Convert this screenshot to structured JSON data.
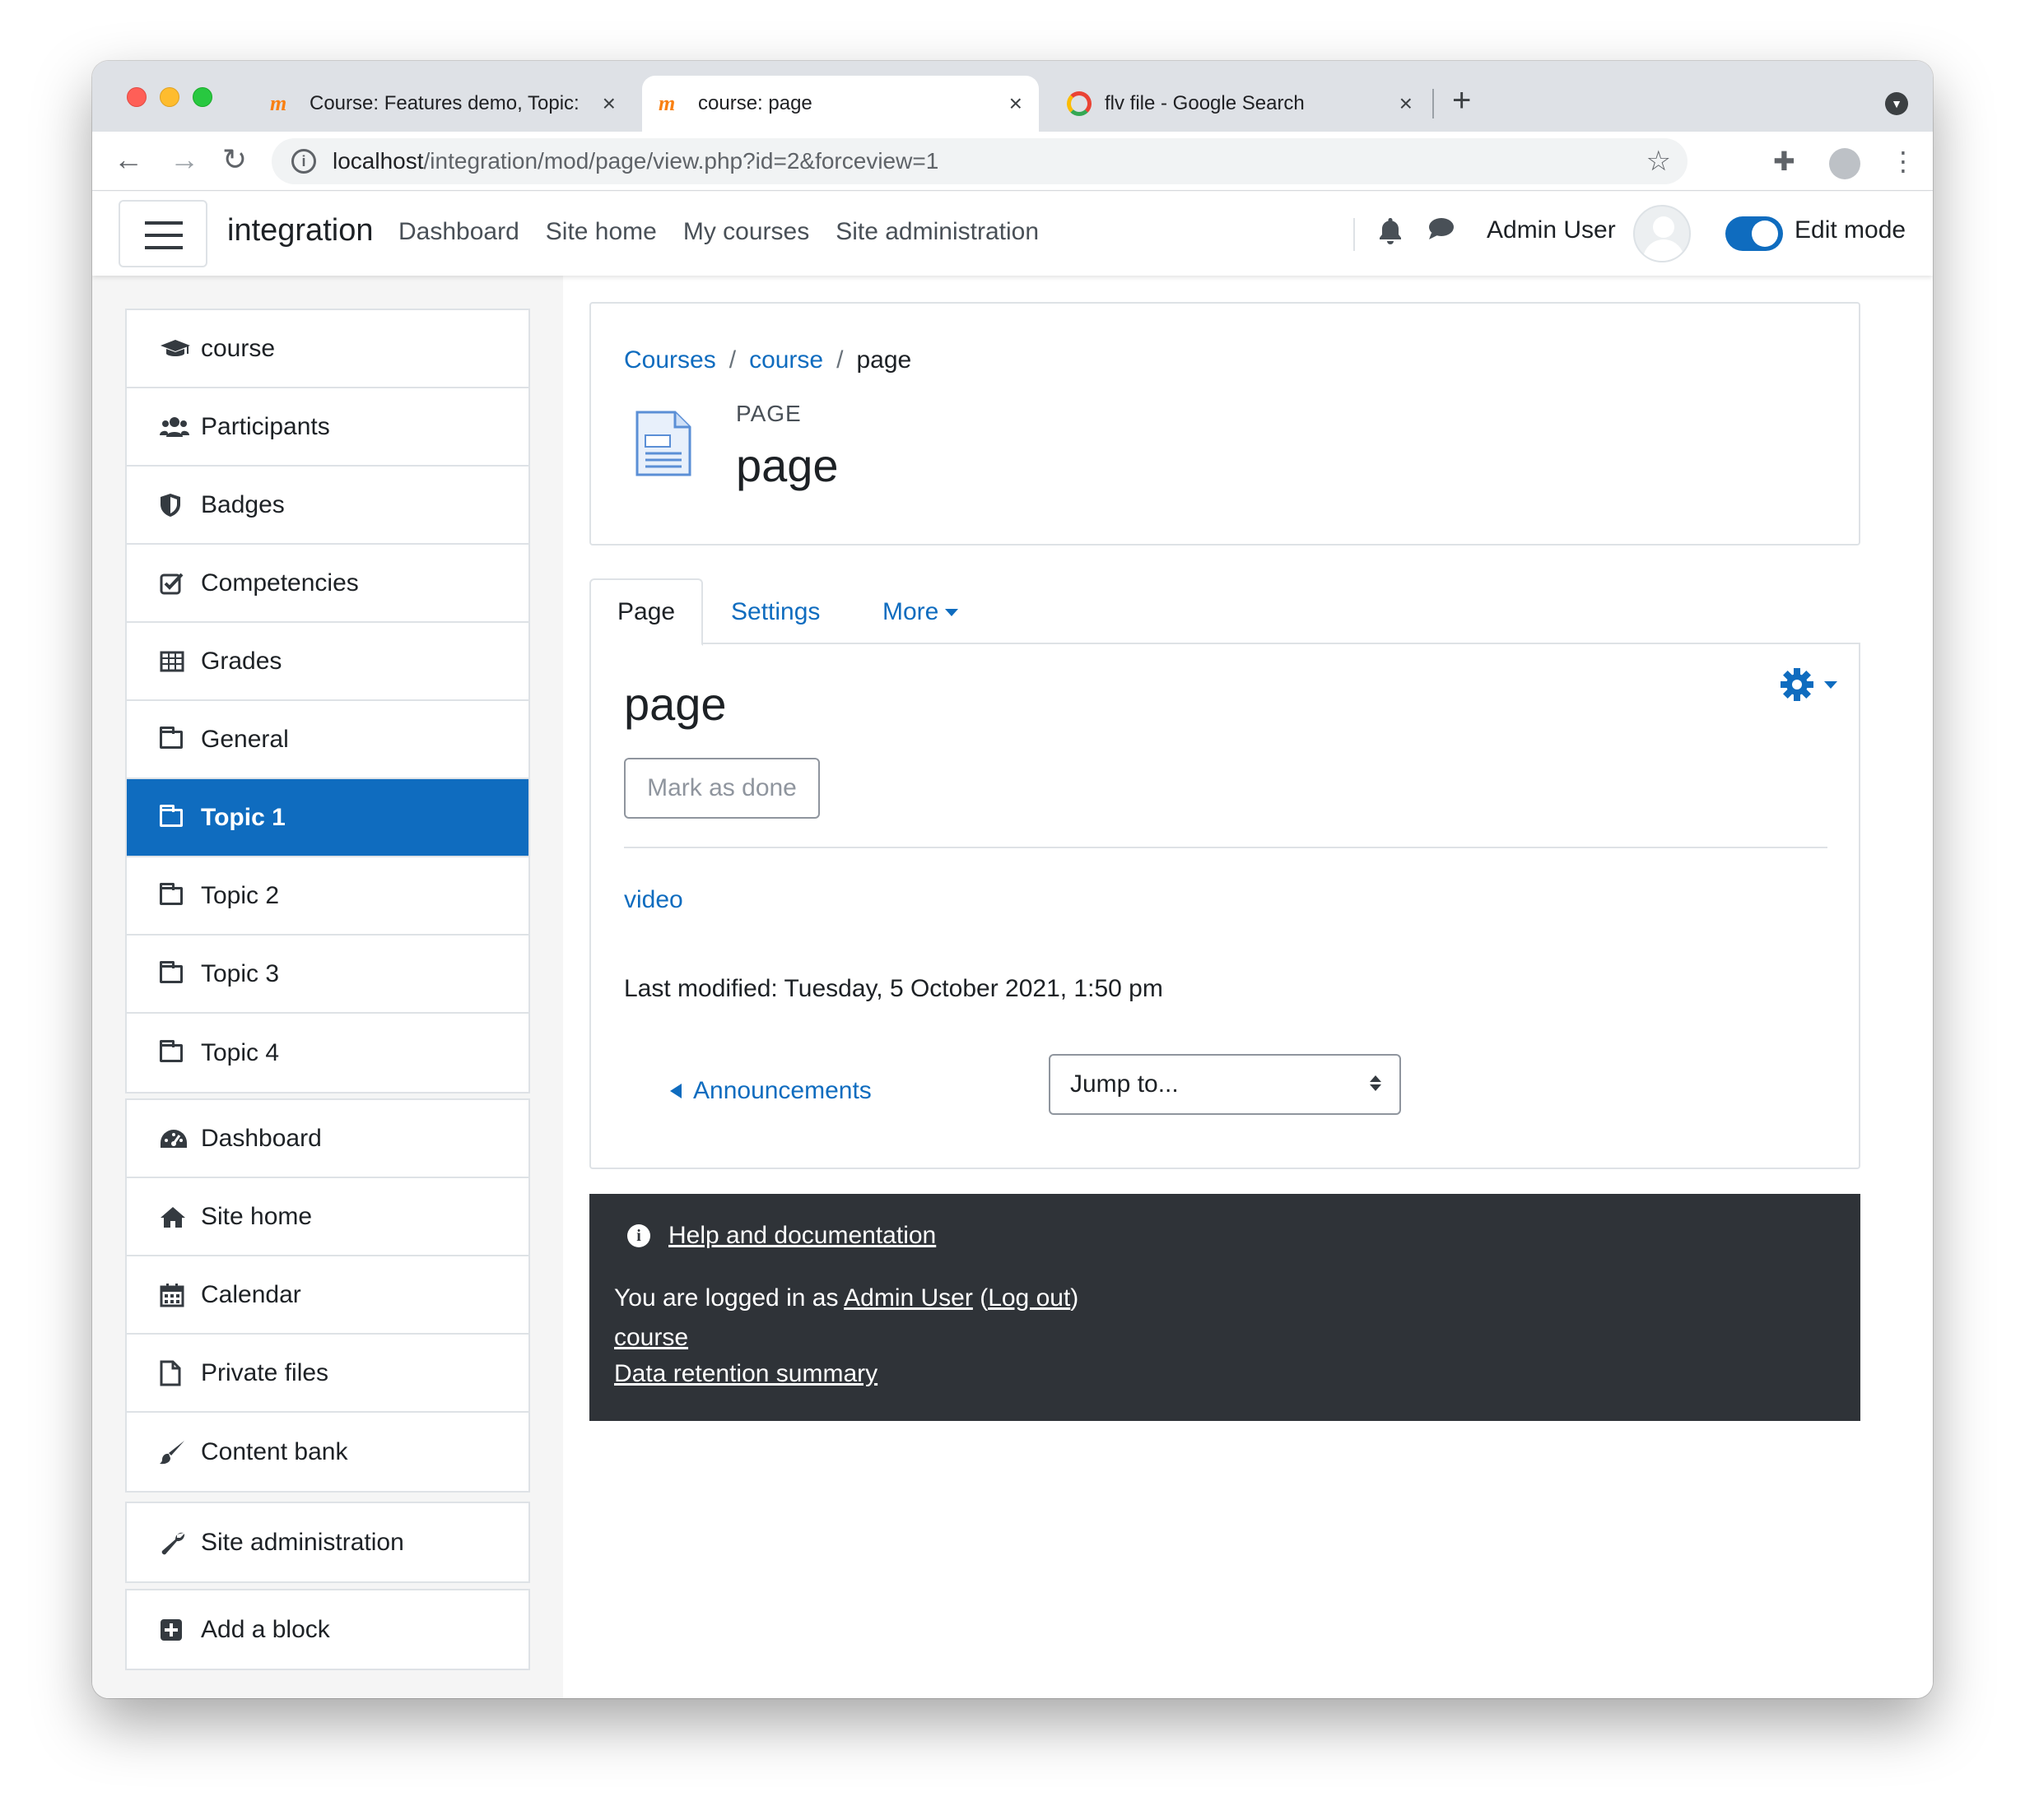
{
  "browser": {
    "tabs": [
      {
        "label": "Course: Features demo, Topic:",
        "active": false
      },
      {
        "label": "course: page",
        "active": true
      },
      {
        "label": "flv file - Google Search",
        "active": false
      }
    ],
    "url_host": "localhost",
    "url_path": "/integration/mod/page/view.php?id=2&forceview=1"
  },
  "navbar": {
    "brand": "integration",
    "links": [
      "Dashboard",
      "Site home",
      "My courses",
      "Site administration"
    ],
    "user": "Admin User",
    "edit_mode_label": "Edit mode",
    "edit_mode_on": true
  },
  "drawer": {
    "course_items": [
      {
        "label": "course",
        "icon": "graduation-cap-icon"
      },
      {
        "label": "Participants",
        "icon": "users-icon"
      },
      {
        "label": "Badges",
        "icon": "shield-icon"
      },
      {
        "label": "Competencies",
        "icon": "checkbox-icon"
      },
      {
        "label": "Grades",
        "icon": "table-icon"
      },
      {
        "label": "General",
        "icon": "folder-icon"
      },
      {
        "label": "Topic 1",
        "icon": "folder-icon",
        "active": true
      },
      {
        "label": "Topic 2",
        "icon": "folder-icon"
      },
      {
        "label": "Topic 3",
        "icon": "folder-icon"
      },
      {
        "label": "Topic 4",
        "icon": "folder-icon"
      }
    ],
    "site_items": [
      {
        "label": "Dashboard",
        "icon": "dashboard-icon"
      },
      {
        "label": "Site home",
        "icon": "home-icon"
      },
      {
        "label": "Calendar",
        "icon": "calendar-icon"
      },
      {
        "label": "Private files",
        "icon": "file-icon"
      },
      {
        "label": "Content bank",
        "icon": "brush-icon"
      }
    ],
    "admin_item": {
      "label": "Site administration",
      "icon": "wrench-icon"
    },
    "add_block": {
      "label": "Add a block",
      "icon": "plus-square-icon"
    }
  },
  "header": {
    "breadcrumb": [
      "Courses",
      "course",
      "page"
    ],
    "module_type": "PAGE",
    "module_title": "page"
  },
  "tabs": {
    "page": "Page",
    "settings": "Settings",
    "more": "More"
  },
  "content": {
    "title": "page",
    "mark_done": "Mark as done",
    "video_link": "video",
    "last_modified": "Last modified: Tuesday, 5 October 2021, 1:50 pm",
    "prev_activity": "Announcements",
    "jump_to": "Jump to..."
  },
  "footer": {
    "help": "Help and documentation",
    "logged_in_prefix": "You are logged in as ",
    "logged_in_user": "Admin User",
    "logout": "Log out",
    "course_link": "course",
    "data_retention": "Data retention summary"
  },
  "colors": {
    "primary": "#0f6cbf",
    "footer_bg": "#2f3338",
    "drawer_bg": "#f5f5f5"
  }
}
